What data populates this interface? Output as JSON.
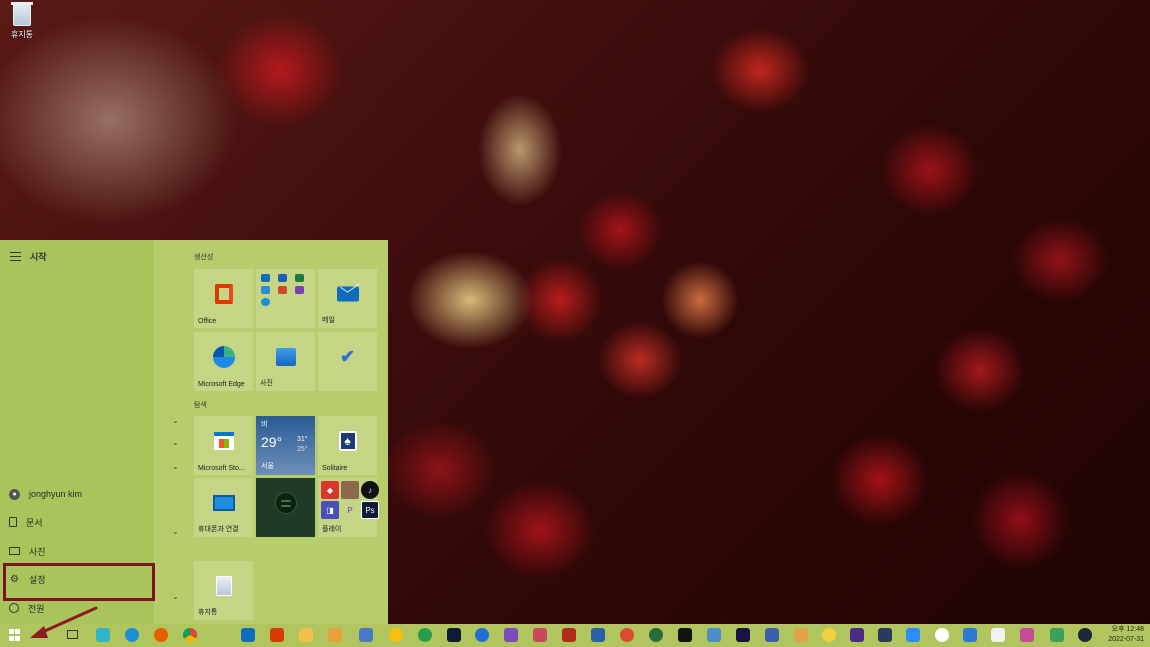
{
  "desktop": {
    "recycle_label": "휴지통"
  },
  "start_menu": {
    "title": "시작",
    "left_items": [
      {
        "label": "jonghyun kim",
        "icon": "user-icon"
      },
      {
        "label": "문서",
        "icon": "document-icon"
      },
      {
        "label": "사진",
        "icon": "pictures-icon"
      },
      {
        "label": "설정",
        "icon": "gear-icon"
      },
      {
        "label": "전원",
        "icon": "power-icon"
      }
    ],
    "groups": {
      "productivity": "생산성",
      "explore": "탐색"
    },
    "tiles": {
      "office": "Office",
      "mail": "메일",
      "edge": "Microsoft Edge",
      "photos": "사진",
      "store": "Microsoft Sto...",
      "solitaire": "Solitaire",
      "phone": "휴대폰과 연결",
      "play": "플레이",
      "recycle": "휴지통"
    },
    "weather": {
      "condition": "비",
      "temp": "29°",
      "high": "31°",
      "low": "25°",
      "city": "서울"
    }
  },
  "taskbar": {
    "time": "오후 12:48",
    "date": "2022-07-31"
  },
  "colors": {
    "start_left": "#a9c45a",
    "start_right": "#b7cc6c",
    "highlight_box": "#7b1420",
    "arrow": "#8b1a22"
  }
}
